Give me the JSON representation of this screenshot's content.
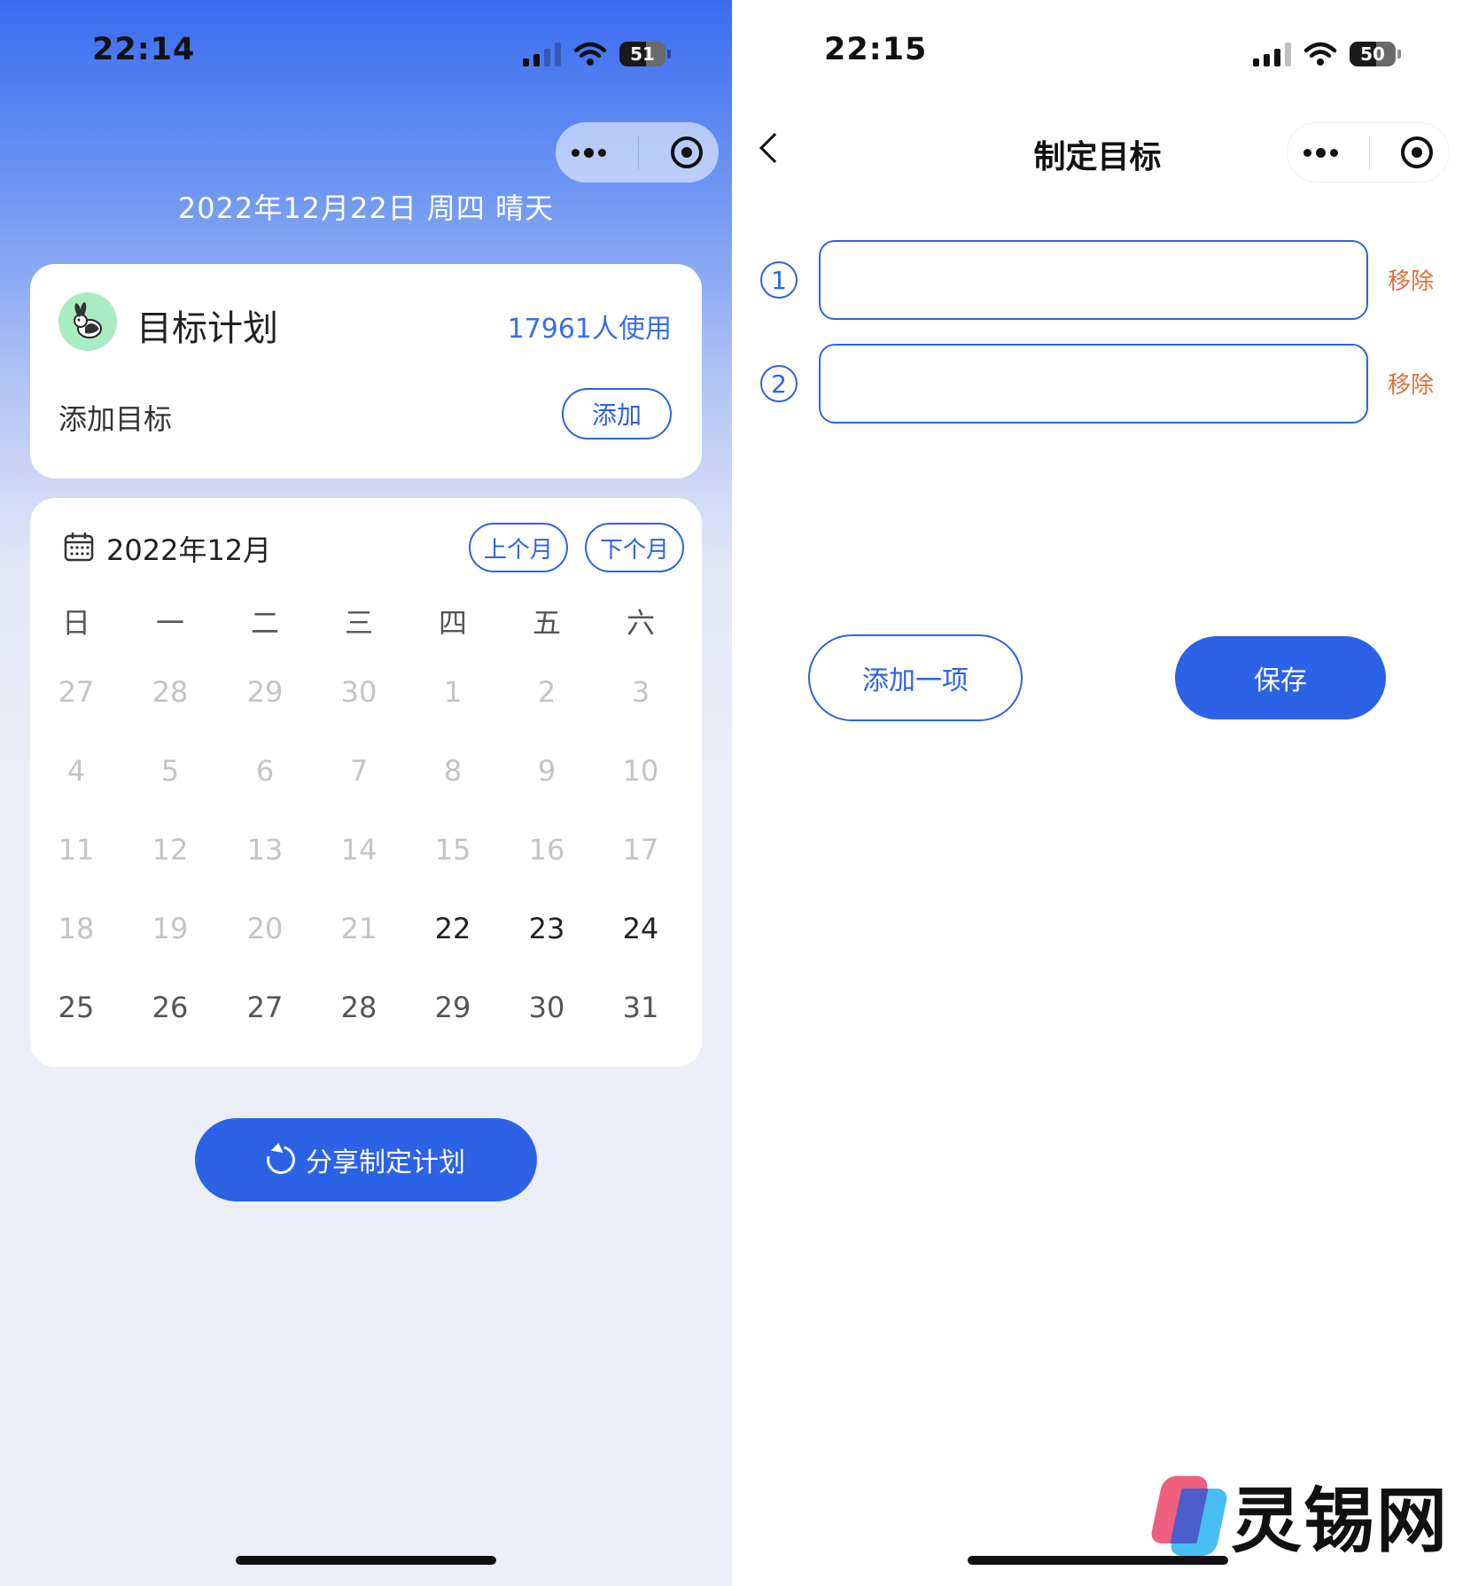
{
  "left": {
    "status": {
      "time": "22:14",
      "battery": "51"
    },
    "date_line": "2022年12月22日 周四 晴天",
    "goal_card": {
      "title": "目标计划",
      "users": "17961人使用",
      "add_label": "添加目标",
      "add_button": "添加"
    },
    "calendar": {
      "month": "2022年12月",
      "prev_label": "上个月",
      "next_label": "下个月",
      "weekdays": [
        "日",
        "一",
        "二",
        "三",
        "四",
        "五",
        "六"
      ],
      "weeks": [
        [
          "27",
          "28",
          "29",
          "30",
          "1",
          "2",
          "3"
        ],
        [
          "4",
          "5",
          "6",
          "7",
          "8",
          "9",
          "10"
        ],
        [
          "11",
          "12",
          "13",
          "14",
          "15",
          "16",
          "17"
        ],
        [
          "18",
          "19",
          "20",
          "21",
          "22",
          "23",
          "24"
        ],
        [
          "25",
          "26",
          "27",
          "28",
          "29",
          "30",
          "31"
        ]
      ],
      "today": "22"
    },
    "share_button": "分享制定计划"
  },
  "right": {
    "status": {
      "time": "22:15",
      "battery": "50"
    },
    "nav_title": "制定目标",
    "rows": [
      {
        "num": "1",
        "value": "",
        "remove": "移除"
      },
      {
        "num": "2",
        "value": "",
        "remove": "移除"
      }
    ],
    "add_item_button": "添加一项",
    "save_button": "保存"
  },
  "watermark": "灵锡网",
  "colors": {
    "primary": "#2b62e6",
    "remove": "#e0703c",
    "avatar_bg": "#a9ecc4"
  }
}
